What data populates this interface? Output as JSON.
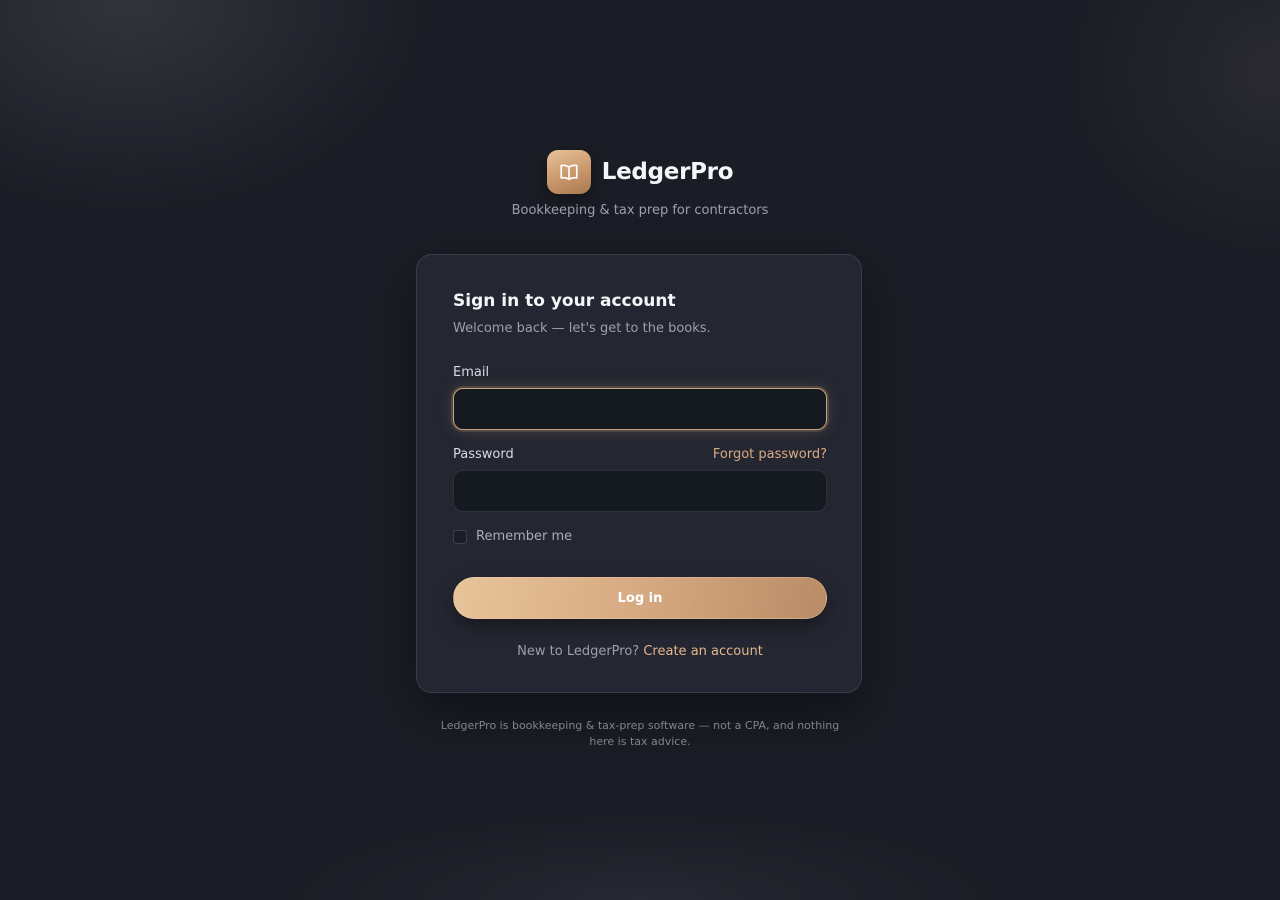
{
  "brand": {
    "name": "LedgerPro",
    "tagline": "Bookkeeping & tax prep for contractors",
    "logo_icon": "open-book-icon",
    "accent_color": "#d8ab80"
  },
  "login_card": {
    "title": "Sign in to your account",
    "subtitle": "Welcome back — let's get to the books.",
    "email": {
      "label": "Email",
      "value": "",
      "placeholder": ""
    },
    "password": {
      "label": "Password",
      "value": "",
      "placeholder": "",
      "forgot_link": "Forgot password?"
    },
    "remember_me": {
      "label": "Remember me",
      "checked": false
    },
    "login_button": "Log in",
    "signup_prompt": "New to LedgerPro?",
    "signup_link": "Create an account"
  },
  "footer": {
    "disclaimer": "LedgerPro is bookkeeping & tax-prep software — not a CPA, and nothing here is tax advice."
  }
}
